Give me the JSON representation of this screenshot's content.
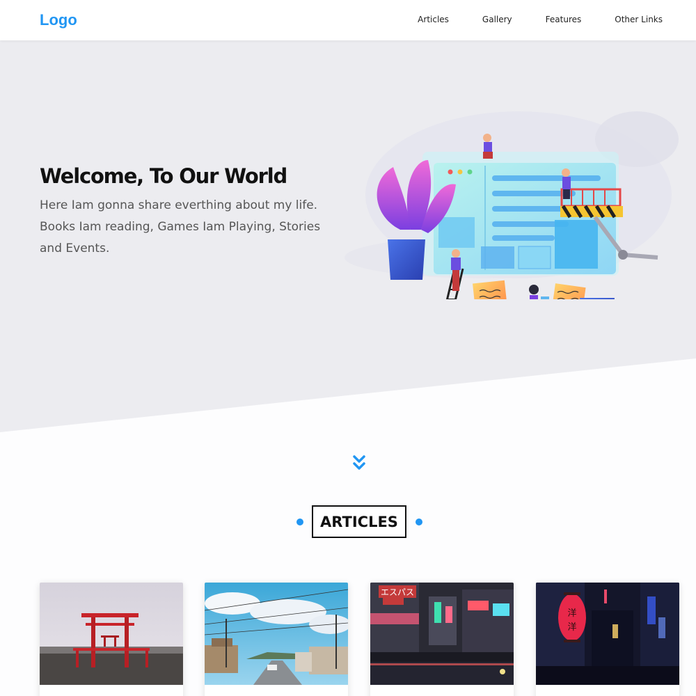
{
  "header": {
    "logo": "Logo",
    "nav": [
      "Articles",
      "Gallery",
      "Features",
      "Other Links"
    ]
  },
  "hero": {
    "title": "Welcome, To Our World",
    "description": "Here Iam gonna share everthing about my life. Books Iam reading, Games Iam Playing, Stories and Events."
  },
  "articles": {
    "heading": "ARTICLES"
  },
  "colors": {
    "accent": "#2196f3",
    "hero_bg": "#ececf0"
  }
}
